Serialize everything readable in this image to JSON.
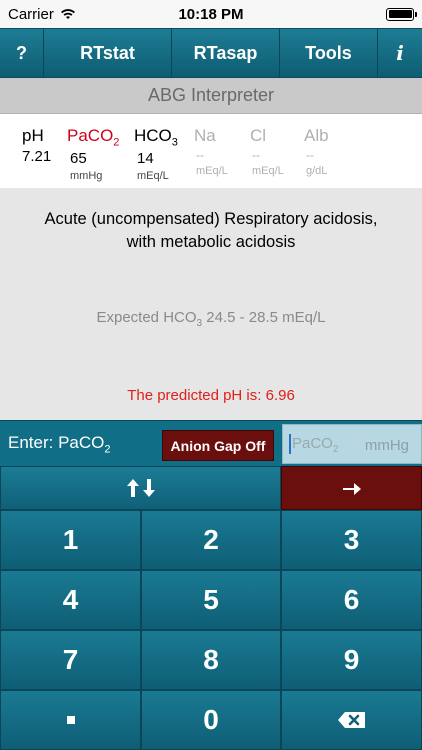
{
  "status_bar": {
    "carrier": "Carrier",
    "time": "10:18 PM"
  },
  "nav": {
    "help": "?",
    "rtstat": "RTstat",
    "rtasap": "RTasap",
    "tools": "Tools",
    "info": "i"
  },
  "title": "ABG Interpreter",
  "values": {
    "ph": {
      "label": "pH",
      "value": "7.21"
    },
    "paco2": {
      "label_main": "PaCO",
      "label_sub": "2",
      "value": "65",
      "unit": "mmHg"
    },
    "hco3": {
      "label_main": "HCO",
      "label_sub": "3",
      "value": "14",
      "unit": "mEq/L"
    },
    "na": {
      "label": "Na",
      "value": "--",
      "unit": "mEq/L"
    },
    "cl": {
      "label": "Cl",
      "value": "--",
      "unit": "mEq/L"
    },
    "alb": {
      "label": "Alb",
      "value": "--",
      "unit": "g/dL"
    }
  },
  "interpretation": {
    "diagnosis_line1": "Acute (uncompensated) Respiratory acidosis,",
    "diagnosis_line2": "with metabolic acidosis",
    "expected_prefix": "Expected HCO",
    "expected_sub": "3",
    "expected_range": " 24.5 - 28.5 mEq/L",
    "predicted": "The predicted pH is: 6.96"
  },
  "entry": {
    "label_main": "Enter: PaCO",
    "label_sub": "2",
    "anion_gap": "Anion Gap Off",
    "placeholder_main": "PaCO",
    "placeholder_sub": "2",
    "unit": "mmHg"
  },
  "keypad": {
    "keys": [
      "1",
      "2",
      "3",
      "4",
      "5",
      "6",
      "7",
      "8",
      "9",
      "0"
    ]
  },
  "colors": {
    "nav_teal": "#106f86",
    "anion_maroon": "#6b0e0e",
    "active_red": "#d0021b"
  }
}
